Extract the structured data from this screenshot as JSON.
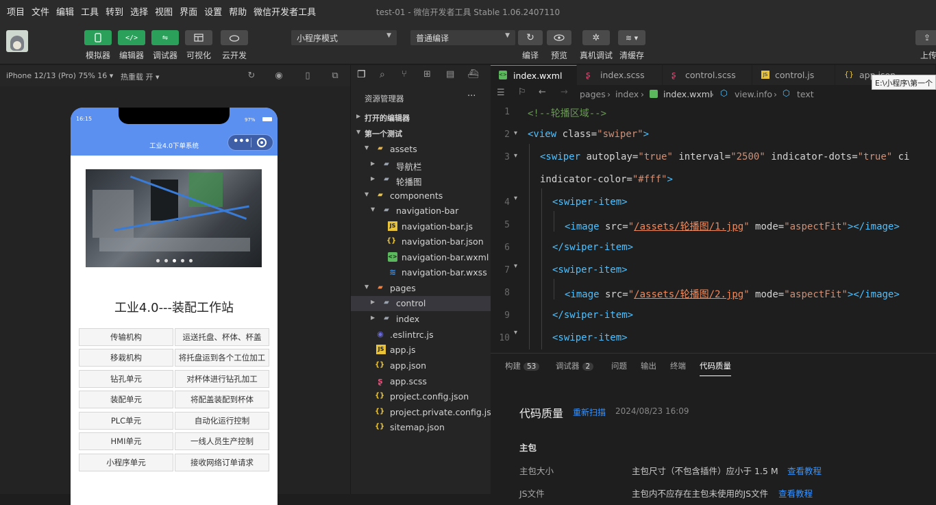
{
  "menu": [
    "项目",
    "文件",
    "编辑",
    "工具",
    "转到",
    "选择",
    "视图",
    "界面",
    "设置",
    "帮助",
    "微信开发者工具"
  ],
  "window_title": "test-01 - 微信开发者工具 Stable 1.06.2407110",
  "toolbar": {
    "simulator": "模拟器",
    "editor": "编辑器",
    "debugger": "调试器",
    "visual": "可视化",
    "cloud": "云开发",
    "mode_select": "小程序模式",
    "compile_select": "普通编译",
    "compile": "编译",
    "preview": "预览",
    "real_debug": "真机调试",
    "clear_cache": "清缓存",
    "upload": "上传"
  },
  "simbar": {
    "device": "iPhone 12/13 (Pro) 75% 16 ▾",
    "hotreload": "热重载 开 ▾"
  },
  "phone": {
    "time": "16:15",
    "battery": "97%",
    "nav_title": "工业4.0下单系统",
    "page_title": "工业4.0---装配工作站",
    "rows": [
      {
        "left": "传输机构",
        "right": "运送托盘、杯体、杯盖"
      },
      {
        "left": "移栽机构",
        "right": "将托盘运到各个工位加工"
      },
      {
        "left": "钻孔单元",
        "right": "对杯体进行钻孔加工"
      },
      {
        "left": "装配单元",
        "right": "将配盖装配到杯体"
      },
      {
        "left": "PLC单元",
        "right": "自动化运行控制"
      },
      {
        "left": "HMI单元",
        "right": "一线人员生产控制"
      },
      {
        "left": "小程序单元",
        "right": "接收网络订单请求"
      }
    ]
  },
  "explorer": {
    "title": "资源管理器",
    "more": "···",
    "open_editors": "打开的编辑器",
    "project": "第一个测试",
    "items": [
      {
        "label": "assets",
        "icon": "folder"
      },
      {
        "label": "导航栏",
        "icon": "folder"
      },
      {
        "label": "轮播图",
        "icon": "folder"
      },
      {
        "label": "components",
        "icon": "folder"
      },
      {
        "label": "navigation-bar",
        "icon": "folder"
      },
      {
        "label": "navigation-bar.js",
        "icon": "js"
      },
      {
        "label": "navigation-bar.json",
        "icon": "json"
      },
      {
        "label": "navigation-bar.wxml",
        "icon": "wxml"
      },
      {
        "label": "navigation-bar.wxss",
        "icon": "wxss"
      },
      {
        "label": "pages",
        "icon": "folder"
      },
      {
        "label": "control",
        "icon": "folder"
      },
      {
        "label": "index",
        "icon": "folder"
      },
      {
        "label": ".eslintrc.js",
        "icon": "eslint"
      },
      {
        "label": "app.js",
        "icon": "js"
      },
      {
        "label": "app.json",
        "icon": "json"
      },
      {
        "label": "app.scss",
        "icon": "scss"
      },
      {
        "label": "project.config.json",
        "icon": "json"
      },
      {
        "label": "project.private.config.js...",
        "icon": "json"
      },
      {
        "label": "sitemap.json",
        "icon": "json"
      }
    ]
  },
  "editor": {
    "tabs": [
      "index.wxml",
      "index.scss",
      "control.scss",
      "control.js",
      "app.json"
    ],
    "tooltip": "E:\\小程序\\第一个",
    "breadcrumb": [
      "pages",
      "index",
      "index.wxml",
      "view.info",
      "text"
    ],
    "line_numbers": [
      "1",
      "2",
      "3",
      "",
      "4",
      "5",
      "6",
      "7",
      "8",
      "9",
      "10"
    ],
    "code": {
      "l1": "<!--轮播区域-->",
      "l2_tag": "<view",
      "l2_attr": " class=",
      "l2_val": "\"swiper\"",
      "l2_end": ">",
      "l3_tag": "<swiper",
      "l3_a1": " autoplay=",
      "l3_v1": "\"true\"",
      "l3_a2": " interval=",
      "l3_v2": "\"2500\"",
      "l3_a3": " indicator-dots=",
      "l3_v3": "\"true\"",
      "l3_a4": " ci",
      "l3b_attr": "indicator-color=",
      "l3b_val": "\"#fff\"",
      "l3b_end": ">",
      "swiper_item_open": "<swiper-item>",
      "swiper_item_close": "</swiper-item>",
      "image_tag": "<image",
      "src_attr": " src=",
      "q": "\"",
      "path1": "/assets/轮播图/1.jpg",
      "path2": "/assets/轮播图/2.jpg",
      "mode_attr": " mode=",
      "mode_val": "\"aspectFit\"",
      "image_end": "></image>"
    }
  },
  "panel": {
    "tabs": [
      {
        "label": "构建",
        "badge": "53"
      },
      {
        "label": "调试器",
        "badge": "2"
      },
      {
        "label": "问题",
        "badge": ""
      },
      {
        "label": "输出",
        "badge": ""
      },
      {
        "label": "终端",
        "badge": ""
      },
      {
        "label": "代码质量",
        "badge": ""
      }
    ],
    "heading": "代码质量",
    "rescan": "重新扫描",
    "date": "2024/08/23 16:09",
    "section": "主包",
    "row1_label": "主包大小",
    "row1_text": "主包尺寸（不包含插件）应小于 1.5 M",
    "row1_link": "查看教程",
    "row2_label": "JS文件",
    "row2_text": "主包内不应存在主包未使用的JS文件",
    "row2_link": "查看教程"
  },
  "colors": {
    "green": "#2aa05a",
    "nav_blue": "#5b8ff0",
    "link_blue": "#3794ff"
  }
}
